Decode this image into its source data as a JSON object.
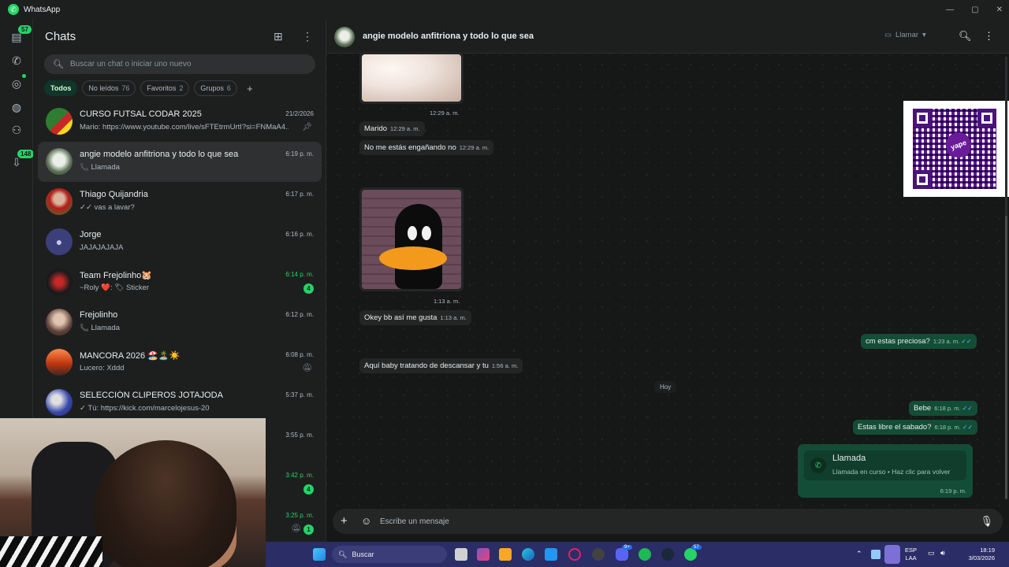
{
  "app": {
    "title": "WhatsApp"
  },
  "rail": {
    "chats_badge": "57",
    "archived_badge": "148"
  },
  "panel": {
    "title": "Chats",
    "search_placeholder": "Buscar un chat o iniciar uno nuevo",
    "filters": [
      {
        "label": "Todos",
        "count": ""
      },
      {
        "label": "No leídos",
        "count": "76"
      },
      {
        "label": "Favoritos",
        "count": "2"
      },
      {
        "label": "Grupos",
        "count": "6"
      }
    ]
  },
  "chats": [
    {
      "name": "CURSO FUTSAL CODAR 2025",
      "preview": "Mario: https://www.youtube.com/live/sFTEtrmUrtI?si=FNMaA4...",
      "time": "21/2/2026",
      "unread": "",
      "icon": "pin-icon"
    },
    {
      "name": "angie modelo anfitriona y todo lo que sea",
      "preview": "📞 Llamada",
      "time": "6:19 p. m.",
      "unread": "",
      "icon": ""
    },
    {
      "name": "Thiago Quijandria",
      "preview": "✓✓ vas a lavar?",
      "time": "6:17 p. m.",
      "unread": "",
      "icon": ""
    },
    {
      "name": "Jorge",
      "preview": "JAJAJAJAJA",
      "time": "6:16 p. m.",
      "unread": "",
      "icon": ""
    },
    {
      "name": "Team Frejolinho🐹",
      "preview": "~Roly ❤️: 🏷 Sticker",
      "time": "6:14 p. m.",
      "unread": "4",
      "icon": ""
    },
    {
      "name": "Frejolinho",
      "preview": "📞 Llamada",
      "time": "6:12 p. m.",
      "unread": "",
      "icon": ""
    },
    {
      "name": "MANCORA 2026 🏖️🏝️☀️",
      "preview": "Lucero: Xddd",
      "time": "6:08 p. m.",
      "unread": "",
      "icon": "mute-icon"
    },
    {
      "name": "SELECCIÓN CLIPEROS JOTAJODA",
      "preview": "✓ Tú: https://kick.com/marcelojesus-20",
      "time": "5:37 p. m.",
      "unread": "",
      "icon": ""
    },
    {
      "name": "",
      "preview": "",
      "time": "3:55 p. m.",
      "unread": "",
      "icon": ""
    },
    {
      "name": "",
      "preview": "",
      "time": "3:42 p. m.",
      "unread": "4",
      "icon": ""
    },
    {
      "name": "",
      "preview": "",
      "time": "3:25 p. m.",
      "unread": "1",
      "icon": "mute-icon"
    }
  ],
  "conversation": {
    "name": "angie modelo anfitriona y todo lo que sea",
    "call_label": "Llamar",
    "messages": [
      {
        "dir": "in",
        "kind": "image",
        "time": "12:29 a. m."
      },
      {
        "dir": "in",
        "kind": "text",
        "text": "Marido",
        "time": "12:29 a. m."
      },
      {
        "dir": "in",
        "kind": "text",
        "text": "No me estás engañando no",
        "time": "12:29 a. m."
      },
      {
        "dir": "in",
        "kind": "image",
        "time": "1:13 a. m."
      },
      {
        "dir": "in",
        "kind": "text",
        "text": "Okey bb así me gusta",
        "time": "1:13 a. m."
      },
      {
        "dir": "out",
        "kind": "text",
        "text": "cm estas preciosa?",
        "time": "1:23 a. m."
      },
      {
        "dir": "in",
        "kind": "text",
        "text": "Aquí baby tratando de descansar y tu",
        "time": "1:56 a. m."
      },
      {
        "dir": "out",
        "kind": "text",
        "text": "Bebe",
        "time": "6:18 p. m."
      },
      {
        "dir": "out",
        "kind": "text",
        "text": "Estas libre el sabado?",
        "time": "6:18 p. m."
      }
    ],
    "day_divider": "Hoy",
    "call_card": {
      "title": "Llamada",
      "subtitle": "Llamada en curso • Haz clic para volver",
      "time": "6:19 p. m."
    },
    "composer_placeholder": "Escribe un mensaje",
    "qr_logo": "yape"
  },
  "taskbar": {
    "search_label": "Buscar",
    "lang_top": "ESP",
    "lang_bottom": "LAA",
    "time": "18:19",
    "date": "3/03/2026",
    "whatsapp_badge": "57",
    "discord_badge": "9+"
  },
  "colors": {
    "accent": "#25d366",
    "outgoing": "#144d37",
    "incoming": "#242626",
    "panel": "#1d1f1f"
  }
}
